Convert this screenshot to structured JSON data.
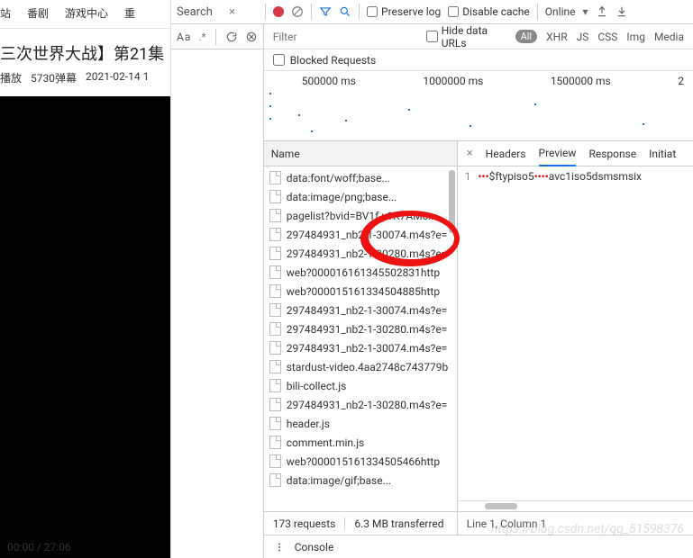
{
  "page_nav": {
    "items": [
      "站",
      "番剧",
      "游戏中心",
      "重"
    ]
  },
  "video": {
    "title_fragment": "三次世界大战】第21集",
    "plays_label": "播放",
    "danmaku": "5730弹幕",
    "date": "2021-02-14 1",
    "time_elapsed": "00:00",
    "time_total": "27:06"
  },
  "devtools": {
    "search_label": "Search",
    "aa_label": "Aa",
    "star_label": ".*",
    "filter_placeholder": "Filter",
    "hide_urls_label": "Hide data URLs",
    "pill_all": "All",
    "types": [
      "XHR",
      "JS",
      "CSS",
      "Img",
      "Media"
    ],
    "preserve_log": "Preserve log",
    "disable_cache": "Disable cache",
    "online": "Online",
    "blocked": "Blocked Requests"
  },
  "timeline": {
    "ticks": [
      "500000 ms",
      "1000000 ms",
      "1500000 ms",
      "2"
    ]
  },
  "network": {
    "name_header": "Name",
    "requests": [
      "data:font/woff;base...",
      "data:image/png;base...",
      "pagelist?bvid=BV1f-y1K7AMc...",
      "297484931_nb2-1-30074.m4s?e=",
      "297484931_nb2-1-30280.m4s?e=",
      "web?000016161345502831http",
      "web?000015161334504885http",
      "297484931_nb2-1-30074.m4s?e=",
      "297484931_nb2-1-30280.m4s?e=",
      "297484931_nb2-1-30074.m4s?e=",
      "stardust-video.4aa2748c743779b",
      "bili-collect.js",
      "297484931_nb2-1-30280.m4s?e=",
      "header.js",
      "comment.min.js",
      "web?000015161334505466http",
      "data:image/gif;base..."
    ],
    "status_requests": "173 requests",
    "status_transferred": "6.3 MB transferred"
  },
  "response": {
    "tabs": {
      "headers": "Headers",
      "preview": "Preview",
      "response": "Response",
      "initiator": "Initiat"
    },
    "line_no": "1",
    "dots1": "•••",
    "frag1": "$ftypiso5",
    "dots2": "••••",
    "frag2": "avc1iso5dsmsmsix",
    "status": "Line 1, Column 1"
  },
  "console": {
    "label": "Console"
  },
  "watermark": "https://blog.csdn.net/qq_51598376"
}
